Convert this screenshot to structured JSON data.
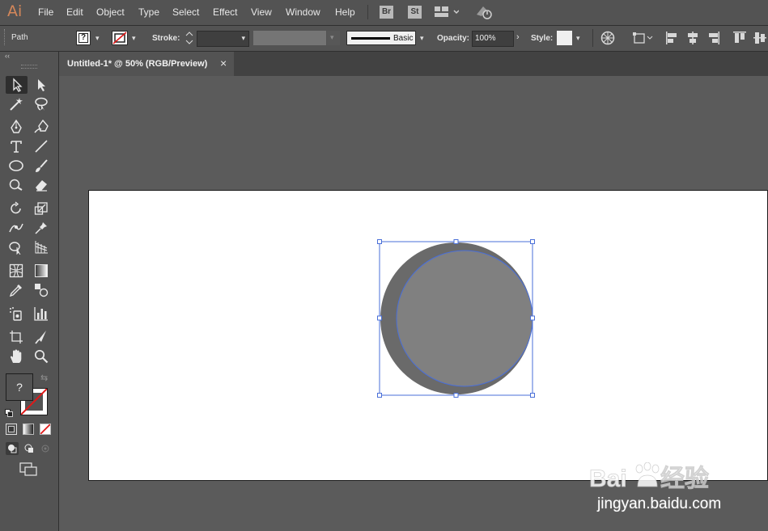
{
  "app": {
    "logo": "Ai"
  },
  "menu": [
    "File",
    "Edit",
    "Object",
    "Type",
    "Select",
    "Effect",
    "View",
    "Window",
    "Help"
  ],
  "toolbar_icons": {
    "bridge": "Br",
    "stock": "St"
  },
  "control": {
    "selection_type": "Path",
    "fill_value": "?",
    "stroke_label": "Stroke:",
    "brush_label": "Basic",
    "opacity_label": "Opacity:",
    "opacity_value": "100%",
    "style_label": "Style:"
  },
  "document_tab": {
    "title": "Untitled-1* @ 50% (RGB/Preview)",
    "close": "×"
  },
  "fill_swatch": {
    "value": "?"
  },
  "colors": {
    "ui_bg": "#535353",
    "canvas_bg": "#5b5b5b",
    "artboard": "#ffffff",
    "circle_fill": "#808080",
    "circle_shadow": "#6a6a6a",
    "selection": "#4a6fd8",
    "logo": "#d4875a"
  },
  "watermark": {
    "brand": "Baidu 经验",
    "url": "jingyan.baidu.com"
  }
}
